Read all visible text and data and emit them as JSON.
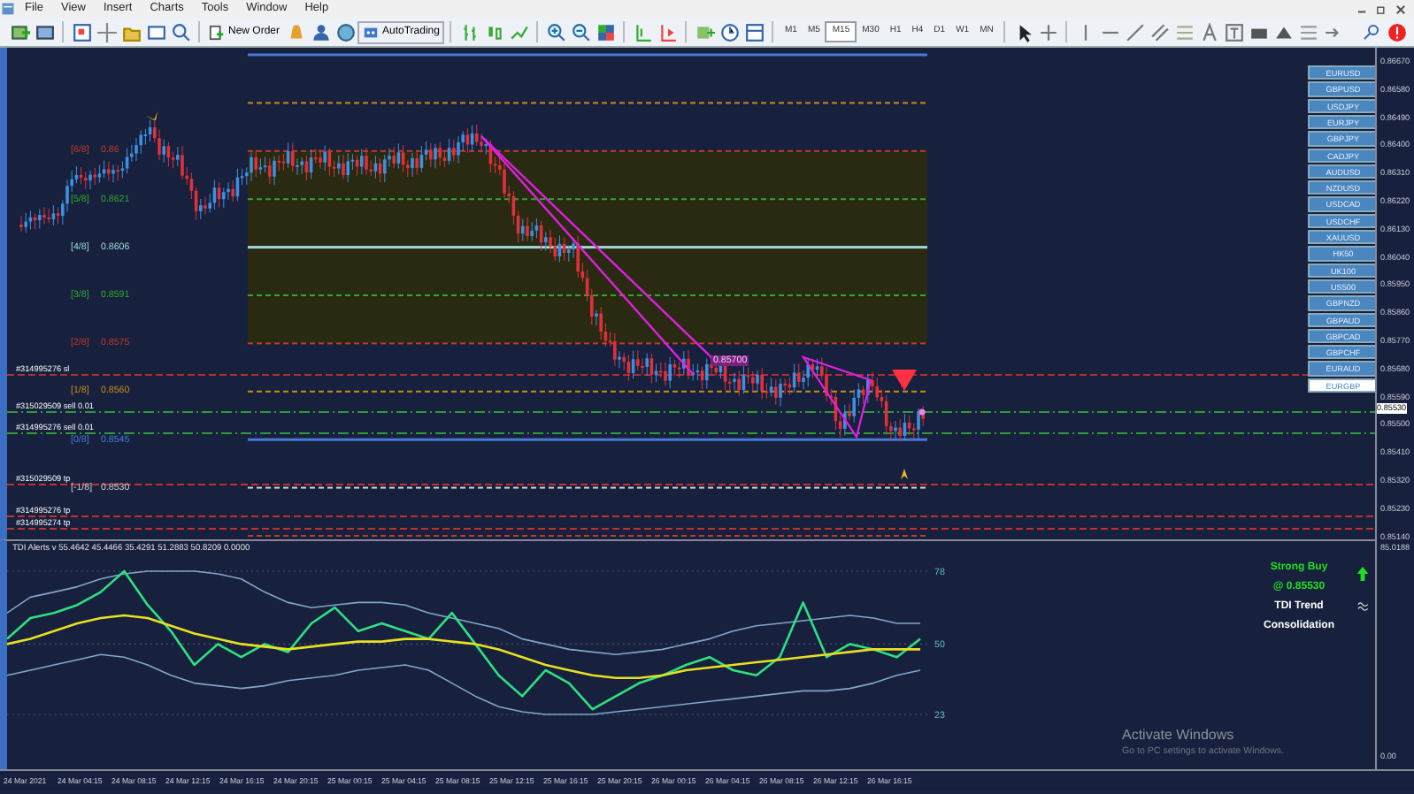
{
  "menu": [
    "File",
    "View",
    "Insert",
    "Charts",
    "Tools",
    "Window",
    "Help"
  ],
  "toolbar": {
    "new_order": "New Order",
    "autotrading": "AutoTrading",
    "timeframes": [
      {
        "label": "M1",
        "selected": false
      },
      {
        "label": "M5",
        "selected": false
      },
      {
        "label": "M15",
        "selected": true
      },
      {
        "label": "M30",
        "selected": false
      },
      {
        "label": "H1",
        "selected": false
      },
      {
        "label": "H4",
        "selected": false
      },
      {
        "label": "D1",
        "selected": false
      },
      {
        "label": "W1",
        "selected": false
      },
      {
        "label": "MN",
        "selected": false
      }
    ]
  },
  "chart": {
    "murrey_levels": [
      {
        "color": "#4a78d8"
      },
      {
        "color": "#c98a1c"
      },
      {
        "label": "[6/8]",
        "value": "0.86",
        "color": "#c0392b"
      },
      {
        "label": "[5/8]",
        "value": "0.8621",
        "color": "#2fa82f"
      },
      {
        "label": "[4/8]",
        "value": "0.8606",
        "color": "#9fd8d8"
      },
      {
        "label": "[3/8]",
        "value": "0.8591",
        "color": "#2fa82f"
      },
      {
        "label": "[2/8]",
        "value": "0.8575",
        "color": "#c0392b"
      },
      {
        "label": "[1/8]",
        "value": "0.8560",
        "color": "#c98a1c"
      },
      {
        "label": "[0/8]",
        "value": "0.8545",
        "color": "#4a78d8"
      },
      {
        "label": "[-1/8]",
        "value": "0.8530",
        "color": "#d0d0d0"
      },
      {
        "color": "#c0392b"
      }
    ],
    "trades": [
      {
        "label": "#314995276 sl",
        "kind": "sl"
      },
      {
        "label": "#315029509 sell 0.01",
        "kind": "sell"
      },
      {
        "label": "#314995276 sell 0.01",
        "kind": "sell"
      },
      {
        "label": "#315029509 tp",
        "kind": "tp"
      },
      {
        "label": "#314995276 tp",
        "kind": "tp"
      },
      {
        "label": "#314995274 tp",
        "kind": "tp"
      }
    ],
    "price_tag": "0.85700",
    "price_axis": [
      "0.86670",
      "0.86580",
      "0.86490",
      "0.86400",
      "0.86310",
      "0.86220",
      "0.86130",
      "0.86040",
      "0.85950",
      "0.85860",
      "0.85770",
      "0.85680",
      "0.85590",
      "0.85500",
      "0.85410",
      "0.85320",
      "0.85230",
      "0.85140"
    ],
    "current_price": "0.85530",
    "symbols": [
      {
        "label": "EURUSD",
        "selected": false
      },
      {
        "label": "GBPUSD",
        "selected": false
      },
      {
        "label": "USDJPY",
        "selected": false
      },
      {
        "label": "EURJPY",
        "selected": false
      },
      {
        "label": "GBPJPY",
        "selected": false
      },
      {
        "label": "CADJPY",
        "selected": false
      },
      {
        "label": "AUDUSD",
        "selected": false
      },
      {
        "label": "NZDUSD",
        "selected": false
      },
      {
        "label": "USDCAD",
        "selected": false
      },
      {
        "label": "USDCHF",
        "selected": false
      },
      {
        "label": "XAUUSD",
        "selected": false
      },
      {
        "label": "HK50",
        "selected": false
      },
      {
        "label": "UK100",
        "selected": false
      },
      {
        "label": "US500",
        "selected": false
      },
      {
        "label": "GBPNZD",
        "selected": false
      },
      {
        "label": "GBPAUD",
        "selected": false
      },
      {
        "label": "GBPCAD",
        "selected": false
      },
      {
        "label": "GBPCHF",
        "selected": false
      },
      {
        "label": "EURAUD",
        "selected": false
      },
      {
        "label": "EURGBP",
        "selected": true
      }
    ]
  },
  "indicator": {
    "title": "TDI Alerts v 55.4642 45.4466 35.4291 51.2883 50.8209 0.0000",
    "chart_data": {
      "type": "line",
      "ylim": [
        23,
        78
      ],
      "grid": true,
      "yticks": [
        {
          "value": 78,
          "label": "78"
        },
        {
          "value": 50,
          "label": "50"
        },
        {
          "value": 23,
          "label": "23"
        }
      ],
      "series": [
        {
          "color": "#7fa8c8",
          "values": [
            62,
            68,
            70,
            72,
            75,
            77,
            78,
            78,
            78,
            77,
            75,
            70,
            66,
            64,
            65,
            66,
            66,
            65,
            62,
            60,
            58,
            56,
            52,
            50,
            48,
            47,
            46,
            47,
            48,
            50,
            52,
            55,
            57,
            58,
            59,
            60,
            61,
            60,
            58,
            58
          ]
        },
        {
          "color": "#7fa8c8",
          "values": [
            38,
            40,
            42,
            44,
            46,
            45,
            42,
            38,
            35,
            34,
            33,
            34,
            36,
            37,
            38,
            40,
            41,
            42,
            40,
            35,
            30,
            26,
            24,
            23,
            23,
            23,
            24,
            25,
            26,
            27,
            28,
            29,
            30,
            31,
            32,
            32,
            33,
            35,
            38,
            40
          ]
        },
        {
          "color": "#30e080",
          "values": [
            52,
            60,
            62,
            65,
            70,
            78,
            65,
            55,
            42,
            50,
            45,
            50,
            47,
            58,
            64,
            55,
            58,
            55,
            52,
            62,
            50,
            38,
            30,
            40,
            35,
            25,
            30,
            35,
            38,
            42,
            45,
            40,
            38,
            45,
            66,
            45,
            50,
            48,
            45,
            52
          ]
        },
        {
          "color": "#e8e020",
          "values": [
            50,
            52,
            55,
            58,
            60,
            61,
            60,
            57,
            54,
            52,
            50,
            49,
            48,
            49,
            50,
            51,
            51,
            52,
            52,
            51,
            50,
            48,
            45,
            42,
            40,
            38,
            37,
            37,
            38,
            40,
            41,
            42,
            43,
            44,
            45,
            46,
            47,
            48,
            48,
            48
          ]
        }
      ]
    },
    "axis": [
      "85.0188",
      "0.00"
    ],
    "signal": "Strong Buy",
    "signal_price": "@ 0.85530",
    "trend_label": "TDI Trend",
    "trend_state": "Consolidation"
  },
  "time_axis": [
    "24 Mar 2021",
    "24 Mar 04:15",
    "24 Mar 08:15",
    "24 Mar 12:15",
    "24 Mar 16:15",
    "24 Mar 20:15",
    "25 Mar 00:15",
    "25 Mar 04:15",
    "25 Mar 08:15",
    "25 Mar 12:15",
    "25 Mar 16:15",
    "25 Mar 20:15",
    "26 Mar 00:15",
    "26 Mar 04:15",
    "26 Mar 08:15",
    "26 Mar 12:15",
    "26 Mar 16:15"
  ],
  "os_notice": {
    "title": "Activate Windows",
    "text": "Go to PC settings to activate Windows."
  }
}
